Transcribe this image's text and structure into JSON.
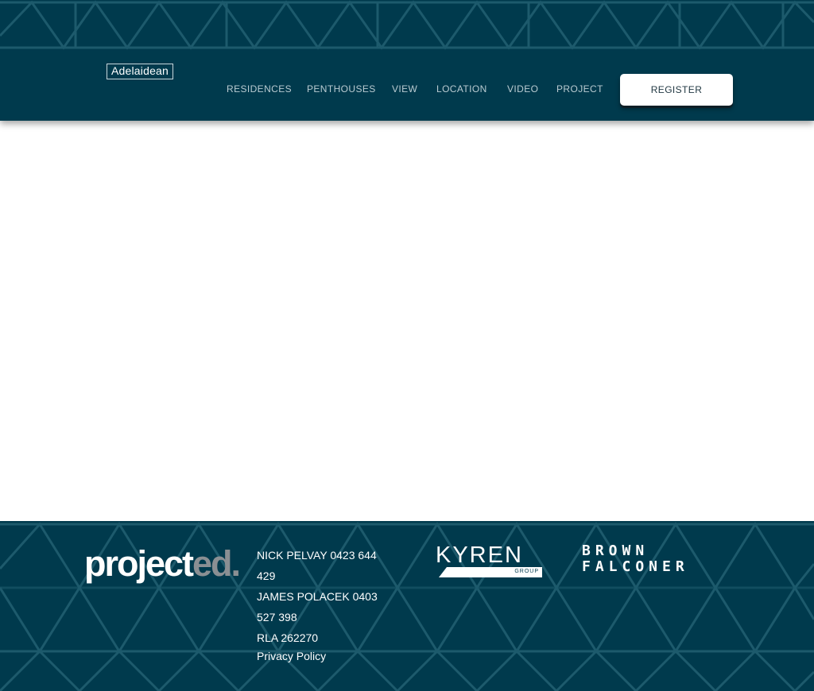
{
  "header": {
    "logo_text": "Adelaidean",
    "nav": [
      "RESIDENCES",
      "PENTHOUSES",
      "VIEW",
      "LOCATION",
      "VIDEO",
      "PROJECT"
    ],
    "register_label": "REGISTER"
  },
  "footer": {
    "brand": {
      "part1": "project",
      "part2": "ed."
    },
    "contacts": [
      "NICK PELVAY   0423 644",
      "429",
      "JAMES POLACEK   0403",
      "527 398",
      "RLA 262270"
    ],
    "privacy_label": "Privacy Policy",
    "kyren": {
      "word": "KYREN",
      "sub": "GROUP"
    },
    "brown_falconer": {
      "line1": "BROWN",
      "line2": "FALCONER"
    }
  },
  "colors": {
    "navy": "#003a4d",
    "pattern": "#1d5a6c",
    "nav_text": "#b9cbd1",
    "white": "#ffffff",
    "accent_grey": "#8a8f93"
  },
  "icons": [
    "geometric-pattern",
    "kyren-logo-bar"
  ]
}
